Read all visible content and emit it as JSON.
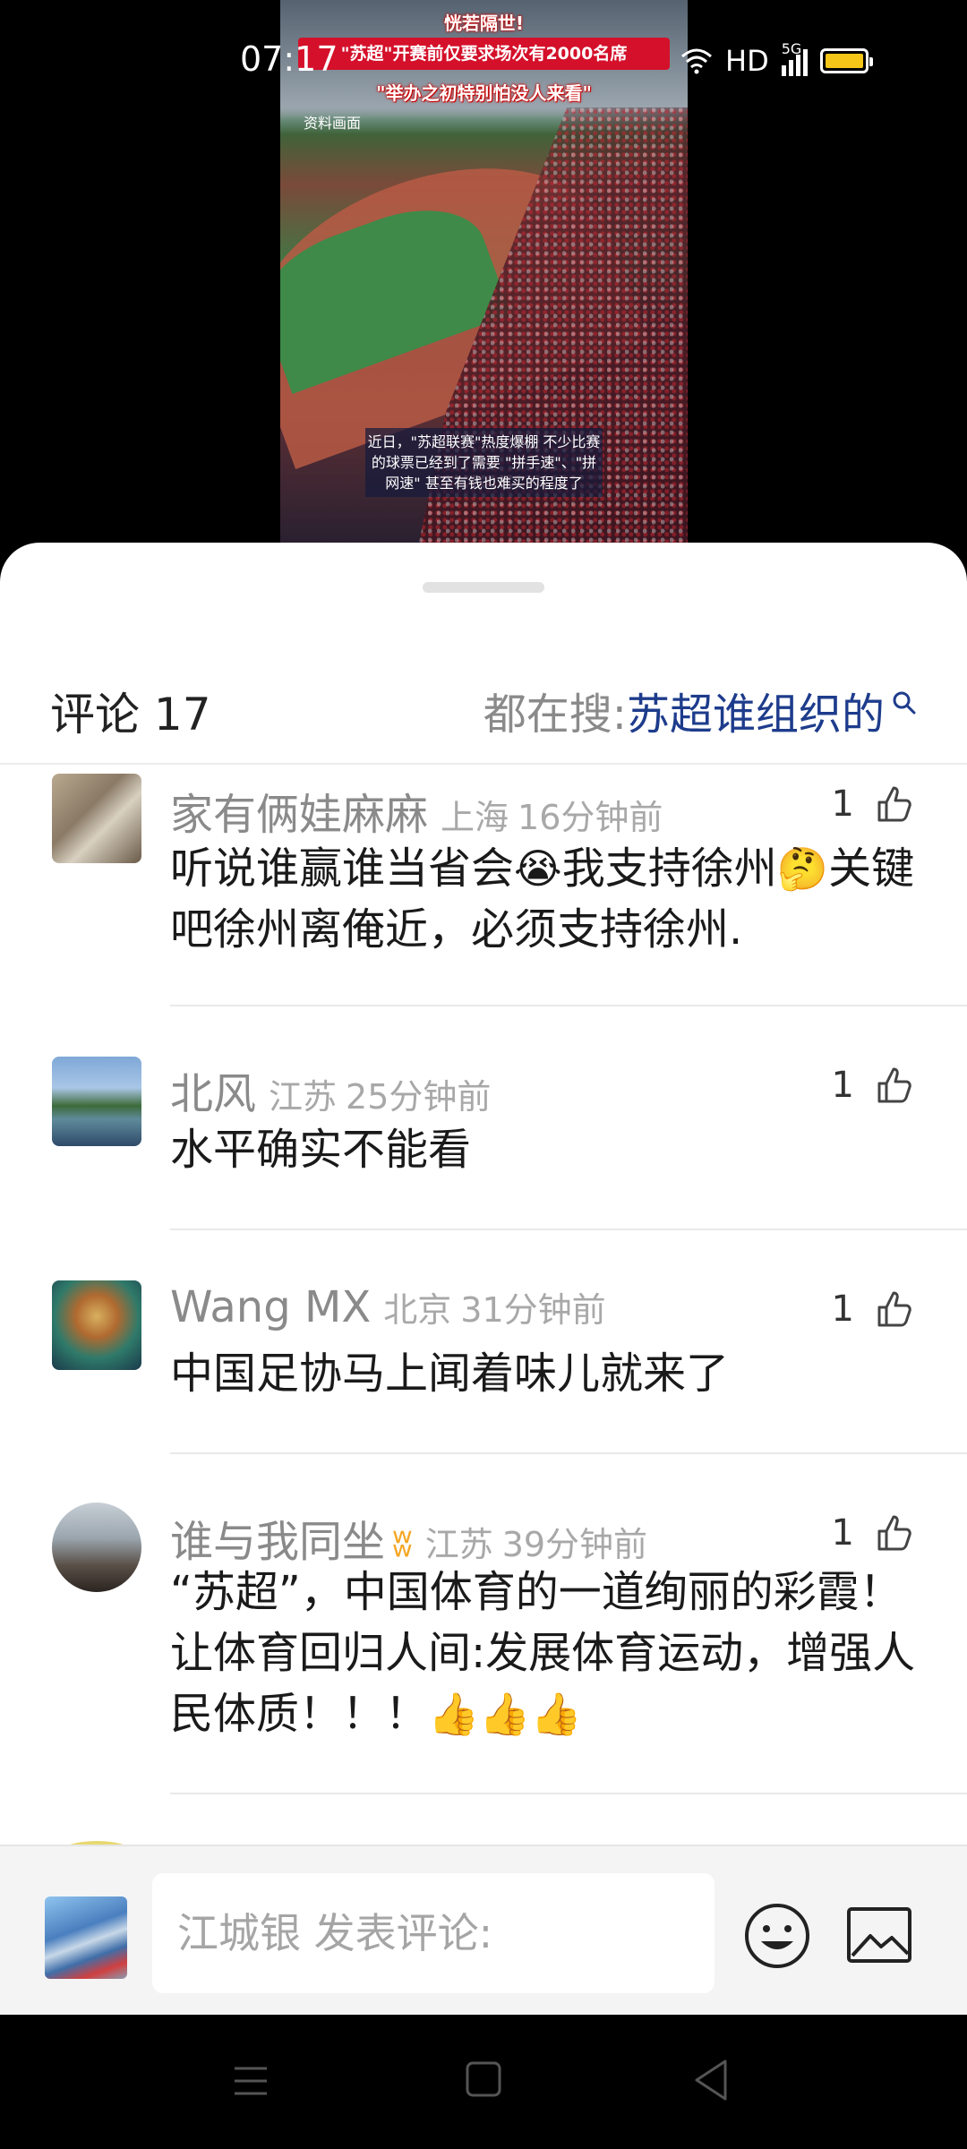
{
  "status_bar": {
    "time": "07:17",
    "network": "HD",
    "signal": "5G",
    "battery_color": "#f5c518"
  },
  "video": {
    "headline_top": "恍若隔世!",
    "headline_banner": "\"苏超\"开赛前仅要求场次有2000名席",
    "headline_bottom": "\"举办之初特别怕没人来看\"",
    "source_tag": "资料画面",
    "caption": "近日，\"苏超联赛\"热度爆棚 不少比赛的球票已经到了需要 \"拼手速\"、\"拼网速\" 甚至有钱也难买的程度了"
  },
  "sheet": {
    "comments_label": "评论 17",
    "search_prefix": "都在搜:",
    "search_term": "苏超谁组织的",
    "search_icon": "search-icon",
    "accent_color": "#1e3c8c"
  },
  "comments": [
    {
      "user": "家有俩娃麻麻",
      "location": "上海",
      "time": "16分钟前",
      "likes": "1",
      "text_a": "听说谁赢谁当省会",
      "emoji_a": "😭",
      "text_b": "我支持徐州",
      "emoji_b": "🤔",
      "text_c": "关键吧徐州离俺近，必须支持徐州."
    },
    {
      "user": "北风",
      "location": "江苏",
      "time": "25分钟前",
      "likes": "1",
      "text": "水平确实不能看"
    },
    {
      "user": "Wang MX",
      "location": "北京",
      "time": "31分钟前",
      "likes": "1",
      "text": "中国足协马上闻着味儿就来了"
    },
    {
      "user": "谁与我同坐",
      "vip_mark": "ʬ",
      "location": "江苏",
      "time": "39分钟前",
      "likes": "1",
      "text": "“苏超”，中国体育的一道绚丽的彩霞！让体育回归人间:发展体育运动，增强人民体质！！！",
      "emoji": "👍👍👍"
    }
  ],
  "input_bar": {
    "placeholder": "江城银 发表评论:"
  }
}
